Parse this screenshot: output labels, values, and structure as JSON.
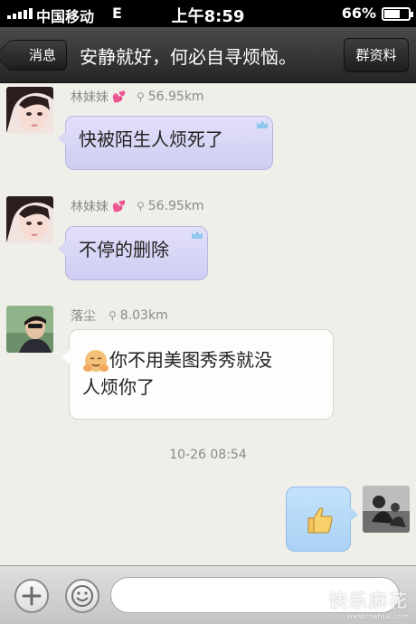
{
  "status_bar": {
    "carrier": "中国移动",
    "network": "E",
    "time": "上午8:59",
    "battery": "66%",
    "battery_level": 0.66
  },
  "nav": {
    "back_label": "消息",
    "title": "安静就好，何必自寻烦恼。",
    "right_button_label": "群资料"
  },
  "messages": [
    {
      "sender": "林妹妹",
      "distance": "56.95km",
      "text": "快被陌生人烦死了",
      "bubble": "purple",
      "badge_icon": "crown-icon"
    },
    {
      "sender": "林妹妹",
      "distance": "56.95km",
      "text": "不停的删除",
      "bubble": "purple",
      "badge_icon": "crown-icon"
    },
    {
      "sender": "落尘",
      "distance": "8.03km",
      "text_line1": "你不用美图秀秀就没",
      "text_line2": "人烦你了",
      "bubble": "white",
      "emoji_icon": "hugging-emoji-icon"
    }
  ],
  "timestamp": "10-26 08:54",
  "outgoing": {
    "sticker_icon": "thumbs-up-icon"
  },
  "input_bar": {
    "placeholder": ""
  },
  "watermark": {
    "text": "快乐麻花",
    "url": "www.mahua.com"
  },
  "colors": {
    "purple_bubble": "#dcdaf7",
    "blue_bubble": "#b4d8f7",
    "background": "#efeee9",
    "nav_bar": "#2b2b2b"
  }
}
